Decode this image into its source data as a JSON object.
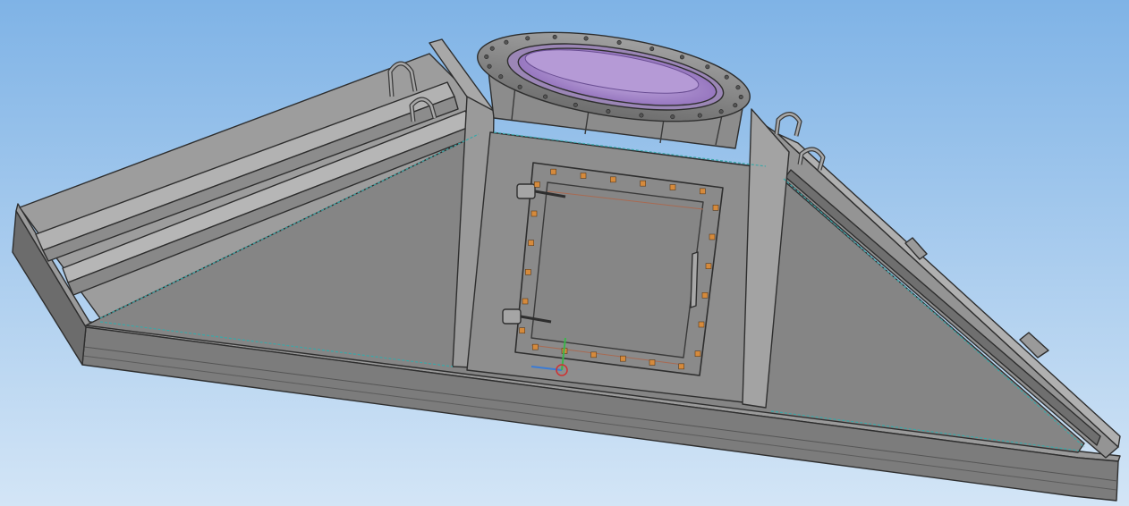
{
  "viewport": {
    "background_top": "#7fb3e6",
    "background_bottom": "#d3e5f6"
  },
  "model": {
    "body_color": "#8a8a8a",
    "edge_color": "#2e2e2e",
    "bolt_color": "#d58a3c",
    "inner_flange_color": "#a585c9",
    "seam_color": "#3aa8a8",
    "icon": "3d-model-icon"
  },
  "axis_triad": {
    "x_color": "#3a7bd5",
    "y_color": "#3bb54a",
    "z_color": "#d03030"
  }
}
